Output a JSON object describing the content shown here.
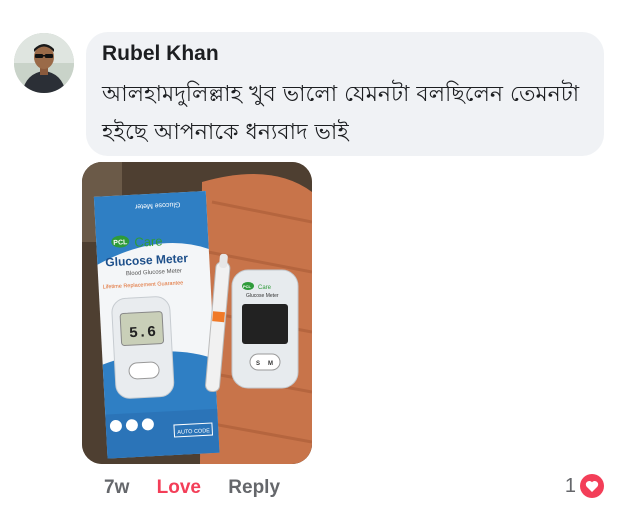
{
  "comment": {
    "author": "Rubel Khan",
    "text": "আলহামদুলিল্লাহ খুব ভালো যেমনটা বলছিলেন তেমনটা হইছে আপনাকে ধন্যবাদ ভাই",
    "photo": {
      "box_brand": "PCL",
      "box_care": "Care",
      "box_title": "Glucose Meter",
      "box_subtitle": "Blood Glucose Meter",
      "box_tagline": "Lifetime Replacement Guarantee",
      "box_reading": "5.6",
      "box_auto_code": "AUTO CODE",
      "meter_brand": "PCL",
      "meter_care": "Care",
      "meter_title": "Glucose Meter",
      "meter_button_s": "S",
      "meter_button_m": "M"
    },
    "actions": {
      "time": "7w",
      "love": "Love",
      "reply": "Reply"
    },
    "reaction_count": "1"
  }
}
